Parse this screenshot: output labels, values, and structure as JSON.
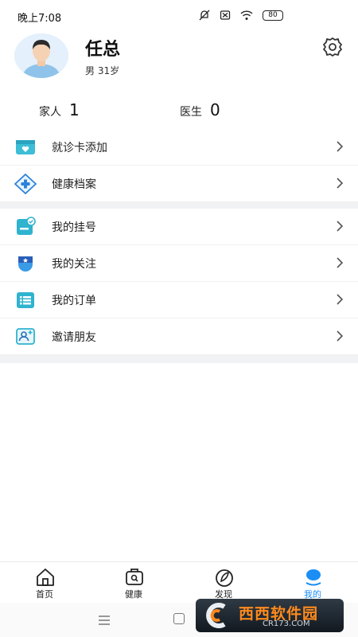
{
  "status_bar": {
    "time": "晚上7:08",
    "battery": "80"
  },
  "profile": {
    "name": "任总",
    "gender_age": "男 31岁"
  },
  "stats": [
    {
      "label": "家人",
      "value": "1"
    },
    {
      "label": "医生",
      "value": "0"
    }
  ],
  "menu_group_1": [
    {
      "label": "就诊卡添加",
      "icon": "card-icon"
    },
    {
      "label": "健康档案",
      "icon": "health-record-icon"
    }
  ],
  "menu_group_2": [
    {
      "label": "我的挂号",
      "icon": "registration-icon"
    },
    {
      "label": "我的关注",
      "icon": "follow-icon"
    },
    {
      "label": "我的订单",
      "icon": "order-icon"
    },
    {
      "label": "邀请朋友",
      "icon": "invite-icon"
    }
  ],
  "tab_bar": [
    {
      "label": "首页",
      "icon": "home-icon",
      "active": false
    },
    {
      "label": "健康",
      "icon": "health-icon",
      "active": false
    },
    {
      "label": "发现",
      "icon": "discover-icon",
      "active": false
    },
    {
      "label": "我的",
      "icon": "profile-icon",
      "active": true
    }
  ],
  "watermark": {
    "main": "西西软件园",
    "sub": "CR173.COM"
  },
  "colors": {
    "accent": "#1a8ef5",
    "divider": "#f1f2f4"
  }
}
